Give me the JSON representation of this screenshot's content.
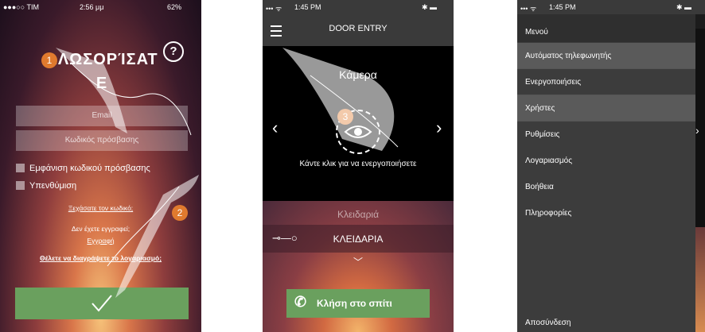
{
  "phone1": {
    "status": {
      "carrier": "●●●○○ TIM",
      "time": "2:56 μμ",
      "battery": "62%"
    },
    "title_line1": "ΑΛΩΣΟΡΊΣΑΤ",
    "title_line2": "Ε",
    "help": "?",
    "email_placeholder": "Email",
    "password_placeholder": "Κωδικός πρόσβασης",
    "show_password": "Εμφάνιση κωδικού πρόσβασης",
    "remember": "Υπενθύμιση",
    "forgot_link": "Ξεχάσατε τον κωδικό;",
    "no_account": "Δεν έχετε εγγραφεί;",
    "register_link": "Εγγραφή",
    "delete_link": "Θέλετε να διαγράψετε το λογαριασμό;",
    "ok_icon": "checkmark-icon",
    "badges": [
      "1",
      "2"
    ]
  },
  "phone2": {
    "status": {
      "carrier": "••• ᯤ",
      "time": "1:45 PM",
      "battery": "✱ ▬"
    },
    "header_title": "DOOR ENTRY",
    "camera_label": "Κάμερα",
    "activate_hint": "Κάντε κλικ για να ενεργοποιήσετε",
    "prev": "‹",
    "next": "›",
    "lock_section": "Κλειδαριά",
    "lock_item": "ΚΛΕΙΔΑΡΙΑ",
    "call_button": "Κλήση στο σπίτι",
    "badge": "3"
  },
  "phone3": {
    "status": {
      "carrier": "••• ᯤ",
      "time": "1:45 PM",
      "battery": "✱ ▬"
    },
    "menu_title": "Μενού",
    "items": [
      "Αυτόματος τηλεφωνητής",
      "Ενεργοποιήσεις",
      "Χρήστες",
      "Ρυθμίσεις",
      "Λογαριασμός",
      "Βοήθεια",
      "Πληροφορίες"
    ],
    "logout": "Αποσύνδεση",
    "behind_arrow": "›"
  },
  "colors": {
    "accent_green": "#6aa05e",
    "badge_orange": "#e07a2e",
    "menu_bg": "#3c3c3c",
    "menu_highlight": "#5a5a5a"
  }
}
